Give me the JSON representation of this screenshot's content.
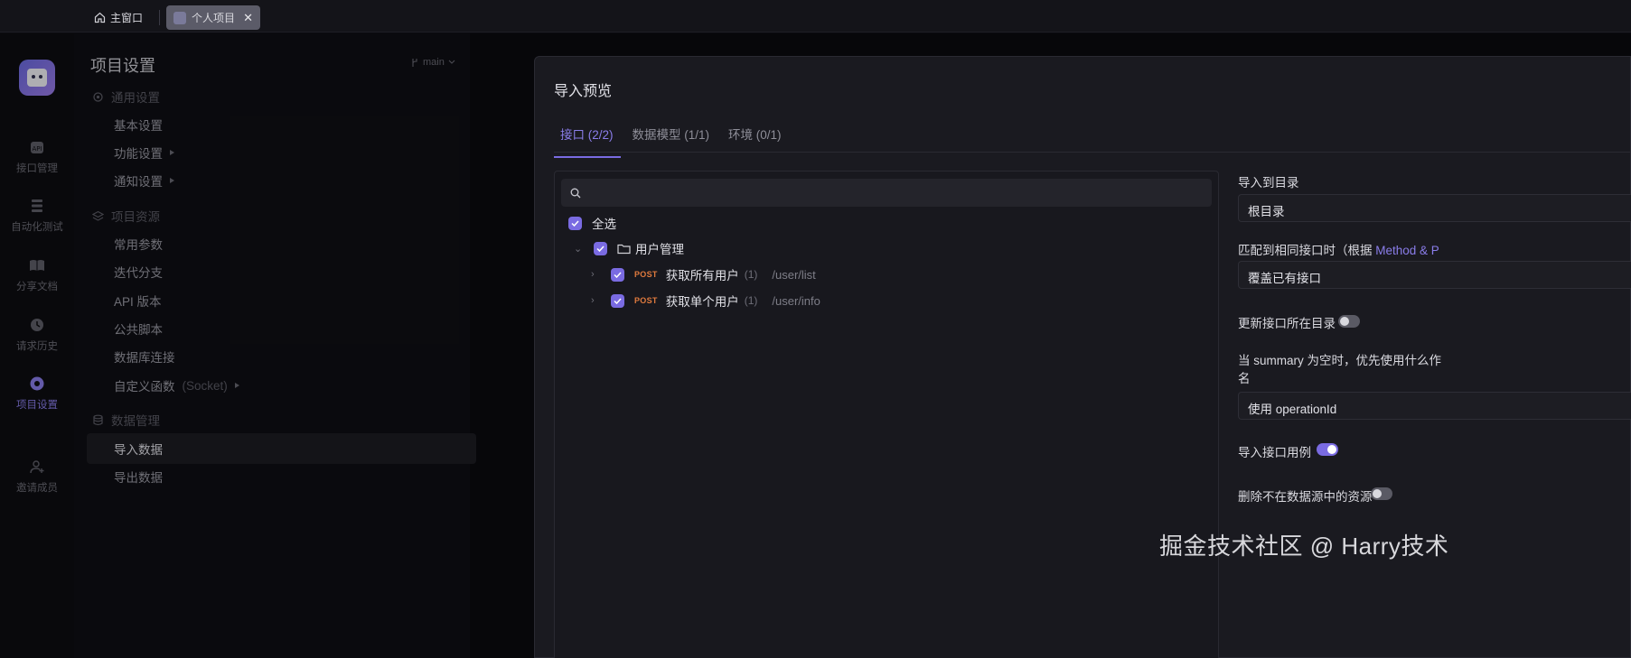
{
  "tabbar": {
    "home_label": "主窗口",
    "active_tab_label": "个人项目",
    "close_glyph": "✕"
  },
  "rail": {
    "items": [
      {
        "label": "接口管理",
        "icon": "api-icon"
      },
      {
        "label": "自动化测试",
        "icon": "automation-icon"
      },
      {
        "label": "分享文档",
        "icon": "book-icon"
      },
      {
        "label": "请求历史",
        "icon": "clock-icon"
      },
      {
        "label": "项目设置",
        "icon": "settings-icon"
      },
      {
        "label": "邀请成员",
        "icon": "add-user-icon"
      }
    ]
  },
  "settings": {
    "title": "项目设置",
    "branch": "main",
    "sections": {
      "general": "通用设置",
      "resources": "项目资源",
      "data": "数据管理"
    },
    "items": {
      "basic": "基本设置",
      "features": "功能设置",
      "notify": "通知设置",
      "params": "常用参数",
      "iteration": "迭代分支",
      "api_version": "API 版本",
      "scripts": "公共脚本",
      "db": "数据库连接",
      "custom_func": "自定义函数",
      "custom_func_suffix": "(Socket)",
      "import": "导入数据",
      "export": "导出数据"
    }
  },
  "modal": {
    "title": "导入预览",
    "tabs": [
      "接口 (2/2)",
      "数据模型 (1/1)",
      "环境 (0/1)"
    ],
    "tree": {
      "select_all": "全选",
      "folder": "用户管理",
      "endpoints": [
        {
          "method": "POST",
          "name": "获取所有用户",
          "count": "(1)",
          "path": "/user/list"
        },
        {
          "method": "POST",
          "name": "获取单个用户",
          "count": "(1)",
          "path": "/user/info"
        }
      ]
    },
    "options": {
      "import_dir_label": "导入到目录",
      "import_dir_value": "根目录",
      "match_label": "匹配到相同接口时（根据 ",
      "match_label_accent": "Method & P",
      "match_value": "覆盖已有接口",
      "update_dir_label": "更新接口所在目录",
      "update_dir_on": false,
      "summary_label_line1": "当 summary 为空时，优先使用什么作",
      "summary_label_line2": "名",
      "summary_value": "使用 operationId",
      "import_cases_label": "导入接口用例",
      "import_cases_on": true,
      "delete_label": "删除不在数据源中的资源",
      "delete_on": false
    }
  },
  "watermark": "掘金技术社区 @ Harry技术",
  "colors": {
    "accent": "#7a6be2",
    "method_post": "#e07a3e"
  }
}
